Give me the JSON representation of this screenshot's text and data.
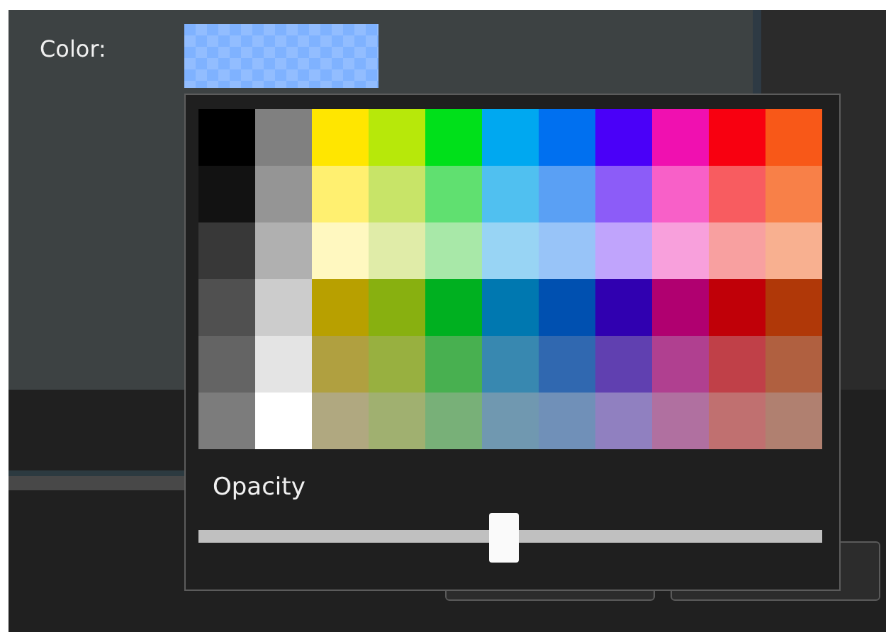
{
  "color_field": {
    "label": "Color:"
  },
  "palette": {
    "rows": [
      {
        "cells": [
          {
            "color": "#000000"
          },
          {
            "color": "#808080"
          },
          {
            "color": "#ffe600"
          },
          {
            "color": "#b7e80a"
          },
          {
            "color": "#00e01a"
          },
          {
            "color": "#00a8f0"
          },
          {
            "color": "#0070f0"
          },
          {
            "color": "#4a00f8"
          },
          {
            "color": "#f010b0"
          },
          {
            "color": "#f80010"
          },
          {
            "color": "#f85818"
          }
        ]
      },
      {
        "cells": [
          {
            "color": "#121212"
          },
          {
            "color": "#959595"
          },
          {
            "color": "#fff070"
          },
          {
            "color": "#c8e468"
          },
          {
            "color": "#60e070"
          },
          {
            "color": "#50c0f0"
          },
          {
            "color": "#5aa0f4"
          },
          {
            "color": "#8c5cf8"
          },
          {
            "color": "#f860c8"
          },
          {
            "color": "#f85c60"
          },
          {
            "color": "#f88048"
          }
        ]
      },
      {
        "cells": [
          {
            "color": "#383838"
          },
          {
            "color": "#b0b0b0"
          },
          {
            "color": "#fff8c0"
          },
          {
            "color": "#e0eca8"
          },
          {
            "color": "#a8e8a8"
          },
          {
            "color": "#98d4f4"
          },
          {
            "color": "#98c4f8"
          },
          {
            "color": "#c0a4fc"
          },
          {
            "color": "#f8a0dc"
          },
          {
            "color": "#f8a0a0"
          },
          {
            "color": "#f8b090"
          }
        ]
      },
      {
        "cells": [
          {
            "color": "#505050"
          },
          {
            "color": "#cccccc"
          },
          {
            "color": "#b8a000"
          },
          {
            "color": "#88b010"
          },
          {
            "color": "#00b020"
          },
          {
            "color": "#0078b0"
          },
          {
            "color": "#0050b0"
          },
          {
            "color": "#3000b0"
          },
          {
            "color": "#b00070"
          },
          {
            "color": "#c00008"
          },
          {
            "color": "#b03808"
          }
        ]
      },
      {
        "cells": [
          {
            "color": "#646464"
          },
          {
            "color": "#e4e4e4"
          },
          {
            "color": "#b0a040"
          },
          {
            "color": "#98b040"
          },
          {
            "color": "#48b050"
          },
          {
            "color": "#3888b0"
          },
          {
            "color": "#3068b0"
          },
          {
            "color": "#6040b0"
          },
          {
            "color": "#b04090"
          },
          {
            "color": "#c04048"
          },
          {
            "color": "#b06040"
          }
        ]
      },
      {
        "cells": [
          {
            "color": "#7c7c7c"
          },
          {
            "color": "#ffffff"
          },
          {
            "color": "#b0a880"
          },
          {
            "color": "#a0b070"
          },
          {
            "color": "#78b078"
          },
          {
            "color": "#7098b0"
          },
          {
            "color": "#7090b8"
          },
          {
            "color": "#9080c0"
          },
          {
            "color": "#b070a0"
          },
          {
            "color": "#c07070"
          },
          {
            "color": "#b08070"
          }
        ]
      }
    ]
  },
  "opacity": {
    "label": "Opacity",
    "level": 0.49
  }
}
